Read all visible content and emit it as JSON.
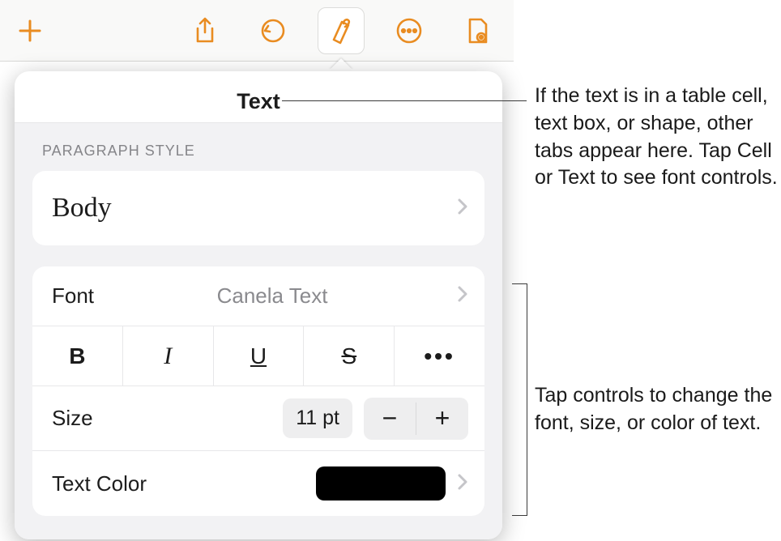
{
  "toolbar": {
    "add": "add",
    "share": "share",
    "undo": "undo",
    "format": "format",
    "more": "more",
    "document": "document"
  },
  "popover": {
    "title": "Text",
    "section_label": "PARAGRAPH STYLE",
    "paragraph_style": "Body",
    "font_label": "Font",
    "font_value": "Canela Text",
    "bold_glyph": "B",
    "italic_glyph": "I",
    "underline_glyph": "U",
    "strike_glyph": "S",
    "more_glyph": "•••",
    "size_label": "Size",
    "size_value": "11 pt",
    "minus_glyph": "−",
    "plus_glyph": "+",
    "textcolor_label": "Text Color",
    "textcolor_value": "#000000"
  },
  "callouts": {
    "c1": "If the text is in a table cell, text box, or shape, other tabs appear here. Tap Cell or Text to see font controls.",
    "c2": "Tap controls to change the font, size, or color of text."
  }
}
